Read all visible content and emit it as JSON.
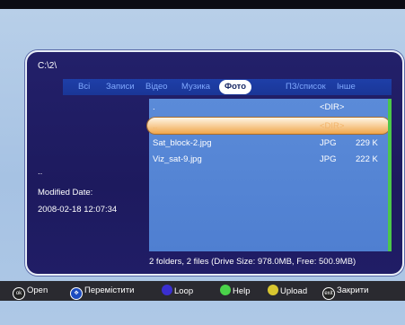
{
  "path": "C:\\2\\",
  "tabs": [
    "Всі",
    "Записи",
    "Відео",
    "Музика",
    "Фото",
    "ПЗ/список",
    "Інше"
  ],
  "selected_tab": "Фото",
  "file_list": [
    {
      "name": ".",
      "type": "<DIR>",
      "size": ""
    },
    {
      "name": "..",
      "type": "<DIR>",
      "size": ""
    },
    {
      "name": "Sat_block-2.jpg",
      "type": "JPG",
      "size": "229 K"
    },
    {
      "name": "Viz_sat-9.jpg",
      "type": "JPG",
      "size": "222 K"
    }
  ],
  "selected_item": "..",
  "details": {
    "name": "..",
    "modified_label": "Modified Date:",
    "modified_value": "2008-02-18 12:07:34"
  },
  "status": "2 folders, 2 files (Drive Size: 978.0MB, Free: 500.9MB)",
  "bottom_bar": [
    {
      "icon": "ok-icon",
      "label": "Open"
    },
    {
      "icon": "move-icon",
      "label": "Перемістити"
    },
    {
      "icon": "blue-button-icon",
      "label": "Loop"
    },
    {
      "icon": "green-button-icon",
      "label": "Help"
    },
    {
      "icon": "yellow-button-icon",
      "label": "Upload"
    },
    {
      "icon": "exit-icon",
      "label": "Закрити"
    }
  ],
  "colors": {
    "panel_bg": "#23206a",
    "list_bg": "#5b8bd8",
    "tab_bar": "#1e3fa8",
    "selection": "#f0a64a"
  }
}
